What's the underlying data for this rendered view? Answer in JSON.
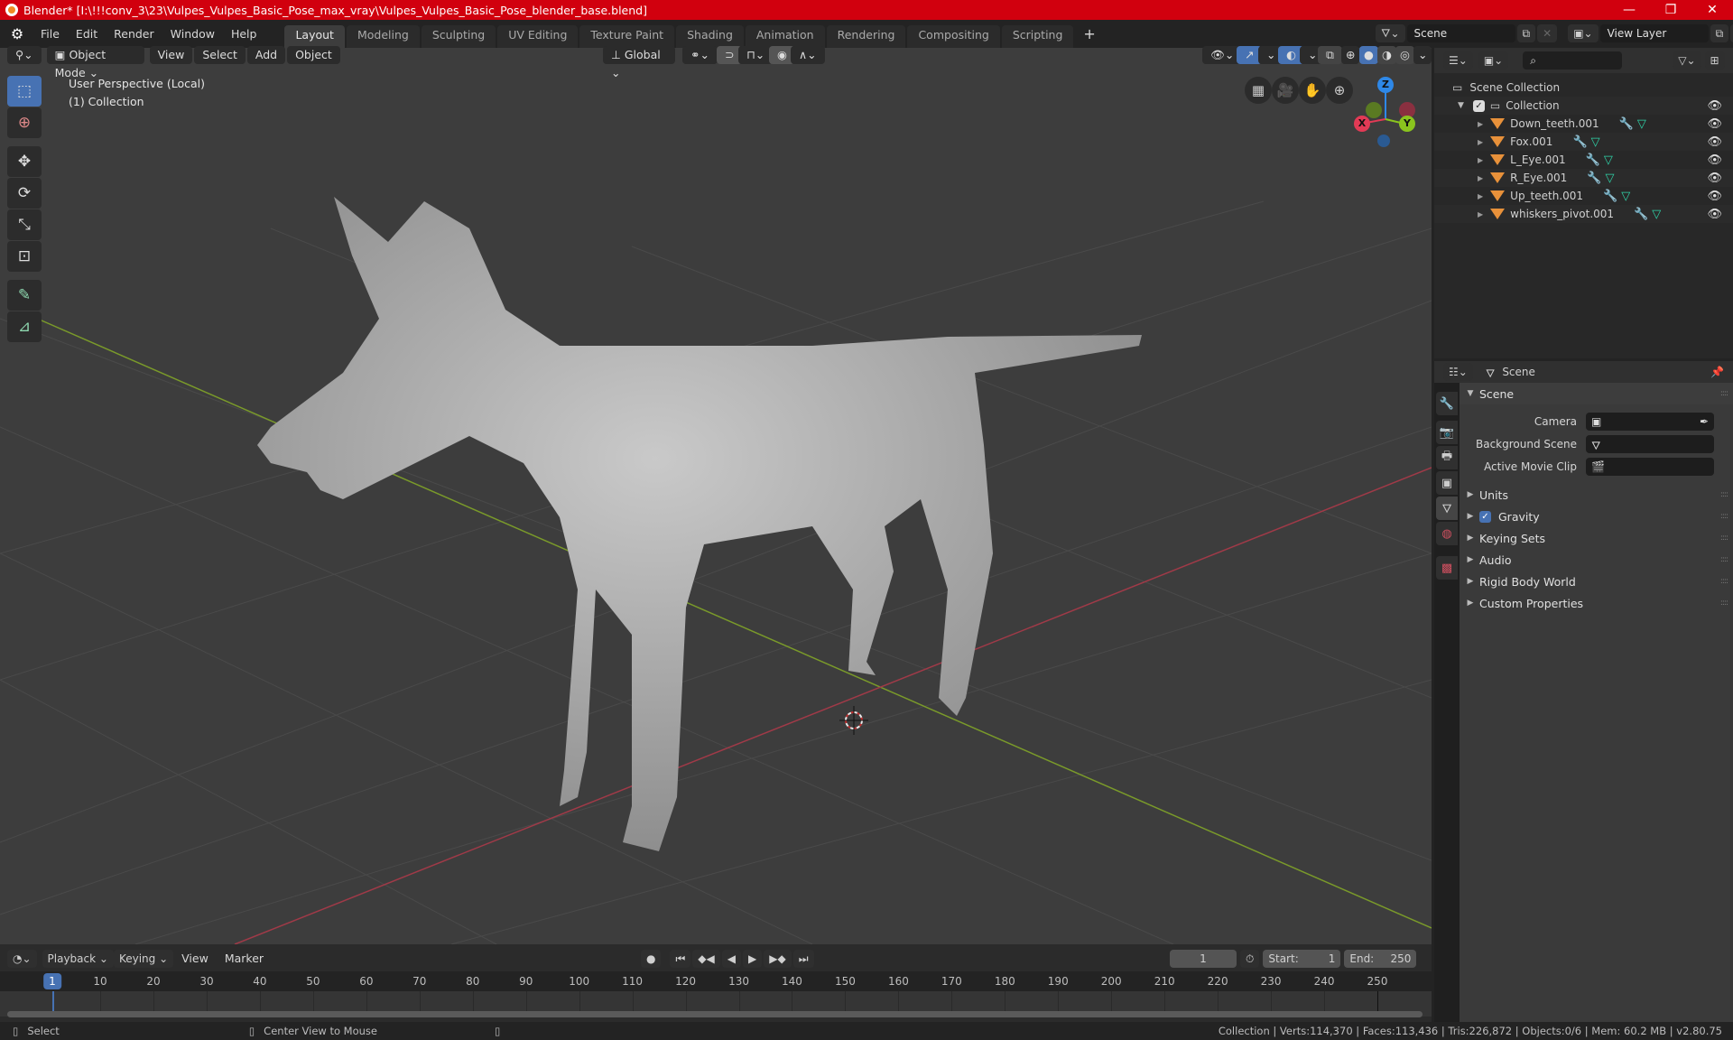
{
  "window": {
    "title": "Blender* [I:\\!!!conv_3\\23\\Vulpes_Vulpes_Basic_Pose_max_vray\\Vulpes_Vulpes_Basic_Pose_blender_base.blend]",
    "controls": {
      "minimize": "—",
      "maximize": "❐",
      "close": "✕"
    }
  },
  "menu": [
    "File",
    "Edit",
    "Render",
    "Window",
    "Help"
  ],
  "workspaces": [
    {
      "label": "Layout",
      "active": true
    },
    {
      "label": "Modeling"
    },
    {
      "label": "Sculpting"
    },
    {
      "label": "UV Editing"
    },
    {
      "label": "Texture Paint"
    },
    {
      "label": "Shading"
    },
    {
      "label": "Animation"
    },
    {
      "label": "Rendering"
    },
    {
      "label": "Compositing"
    },
    {
      "label": "Scripting"
    }
  ],
  "add_workspace": "+",
  "scene_selector": {
    "value": "Scene"
  },
  "view_layer_selector": {
    "value": "View Layer"
  },
  "viewport": {
    "mode": "Object Mode",
    "menus": [
      "View",
      "Select",
      "Add",
      "Object"
    ],
    "orientation": "Global",
    "overlay_text": [
      "User Perspective (Local)",
      "(1) Collection"
    ],
    "gizmo_axes": {
      "x": "X",
      "y": "Y",
      "z": "Z"
    },
    "colors": {
      "x_axis": "#e23a55",
      "y_axis": "#8ac41e",
      "z_axis": "#2e88e8",
      "accent": "#4772b3"
    }
  },
  "tools": [
    {
      "name": "select-box",
      "glyph": "⬚",
      "active": true
    },
    {
      "name": "cursor",
      "glyph": "⊕"
    },
    {
      "name": "move",
      "glyph": "✥"
    },
    {
      "name": "rotate",
      "glyph": "⟳"
    },
    {
      "name": "scale",
      "glyph": "⤡"
    },
    {
      "name": "transform",
      "glyph": "⊡"
    },
    {
      "name": "annotate",
      "glyph": "✎"
    },
    {
      "name": "measure",
      "glyph": "📐"
    }
  ],
  "outliner": {
    "root": "Scene Collection",
    "collection": "Collection",
    "objects": [
      {
        "name": "Down_teeth.001"
      },
      {
        "name": "Fox.001"
      },
      {
        "name": "L_Eye.001"
      },
      {
        "name": "R_Eye.001"
      },
      {
        "name": "Up_teeth.001"
      },
      {
        "name": "whiskers_pivot.001"
      }
    ],
    "search_placeholder": ""
  },
  "properties": {
    "context": "Scene",
    "panel_title": "Scene",
    "fields": [
      {
        "label": "Camera",
        "value": ""
      },
      {
        "label": "Background Scene",
        "value": ""
      },
      {
        "label": "Active Movie Clip",
        "value": ""
      }
    ],
    "subpanels": [
      {
        "label": "Units"
      },
      {
        "label": "Gravity",
        "checkbox": true,
        "checked": true
      },
      {
        "label": "Keying Sets"
      },
      {
        "label": "Audio"
      },
      {
        "label": "Rigid Body World"
      },
      {
        "label": "Custom Properties"
      }
    ]
  },
  "timeline": {
    "menus": [
      "Playback",
      "Keying",
      "View",
      "Marker"
    ],
    "current_frame": "1",
    "start_label": "Start:",
    "start": "1",
    "end_label": "End:",
    "end": "250",
    "ruler_ticks": [
      "1",
      "10",
      "20",
      "30",
      "40",
      "50",
      "60",
      "70",
      "80",
      "90",
      "100",
      "110",
      "120",
      "130",
      "140",
      "150",
      "160",
      "170",
      "180",
      "190",
      "200",
      "210",
      "220",
      "230",
      "240",
      "250"
    ]
  },
  "statusbar": {
    "left_hint": "Select",
    "middle_hint": "Center View to Mouse",
    "stats": "Collection | Verts:114,370 | Faces:113,436 | Tris:226,872 | Objects:0/6 | Mem: 60.2 MB | v2.80.75"
  }
}
